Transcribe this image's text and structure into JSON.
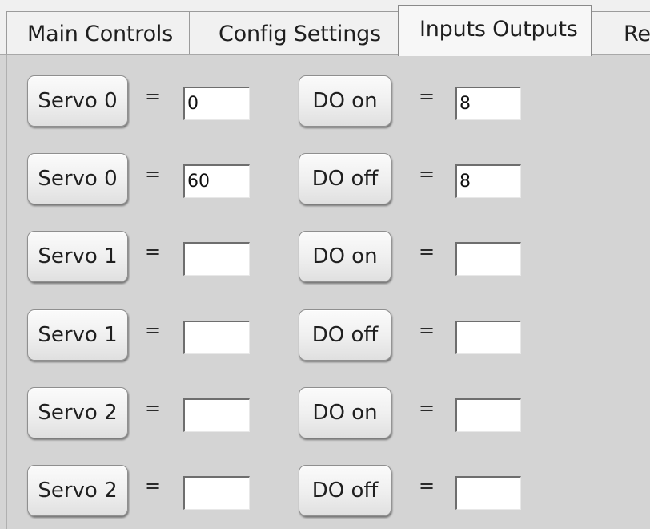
{
  "tabs": [
    {
      "label": "Main Controls"
    },
    {
      "label": "Config Settings"
    },
    {
      "label": "Inputs Outputs",
      "selected": true
    },
    {
      "label": "Re"
    }
  ],
  "rows": [
    {
      "servo_label": "Servo 0",
      "servo_eq": "=",
      "servo_value": "0",
      "do_label": "DO on",
      "do_eq": "=",
      "do_value": "8"
    },
    {
      "servo_label": "Servo 0",
      "servo_eq": "=",
      "servo_value": "60",
      "do_label": "DO off",
      "do_eq": "=",
      "do_value": "8"
    },
    {
      "servo_label": "Servo 1",
      "servo_eq": "=",
      "servo_value": "",
      "do_label": "DO on",
      "do_eq": "=",
      "do_value": ""
    },
    {
      "servo_label": "Servo 1",
      "servo_eq": "=",
      "servo_value": "",
      "do_label": "DO off",
      "do_eq": "=",
      "do_value": ""
    },
    {
      "servo_label": "Servo 2",
      "servo_eq": "=",
      "servo_value": "",
      "do_label": "DO on",
      "do_eq": "=",
      "do_value": ""
    },
    {
      "servo_label": "Servo 2",
      "servo_eq": "=",
      "servo_value": "",
      "do_label": "DO off",
      "do_eq": "=",
      "do_value": ""
    }
  ],
  "colors": {
    "panel_background": "#d4d4d4",
    "tabstrip_background": "#f0f0f0",
    "field_background": "#ffffff"
  }
}
